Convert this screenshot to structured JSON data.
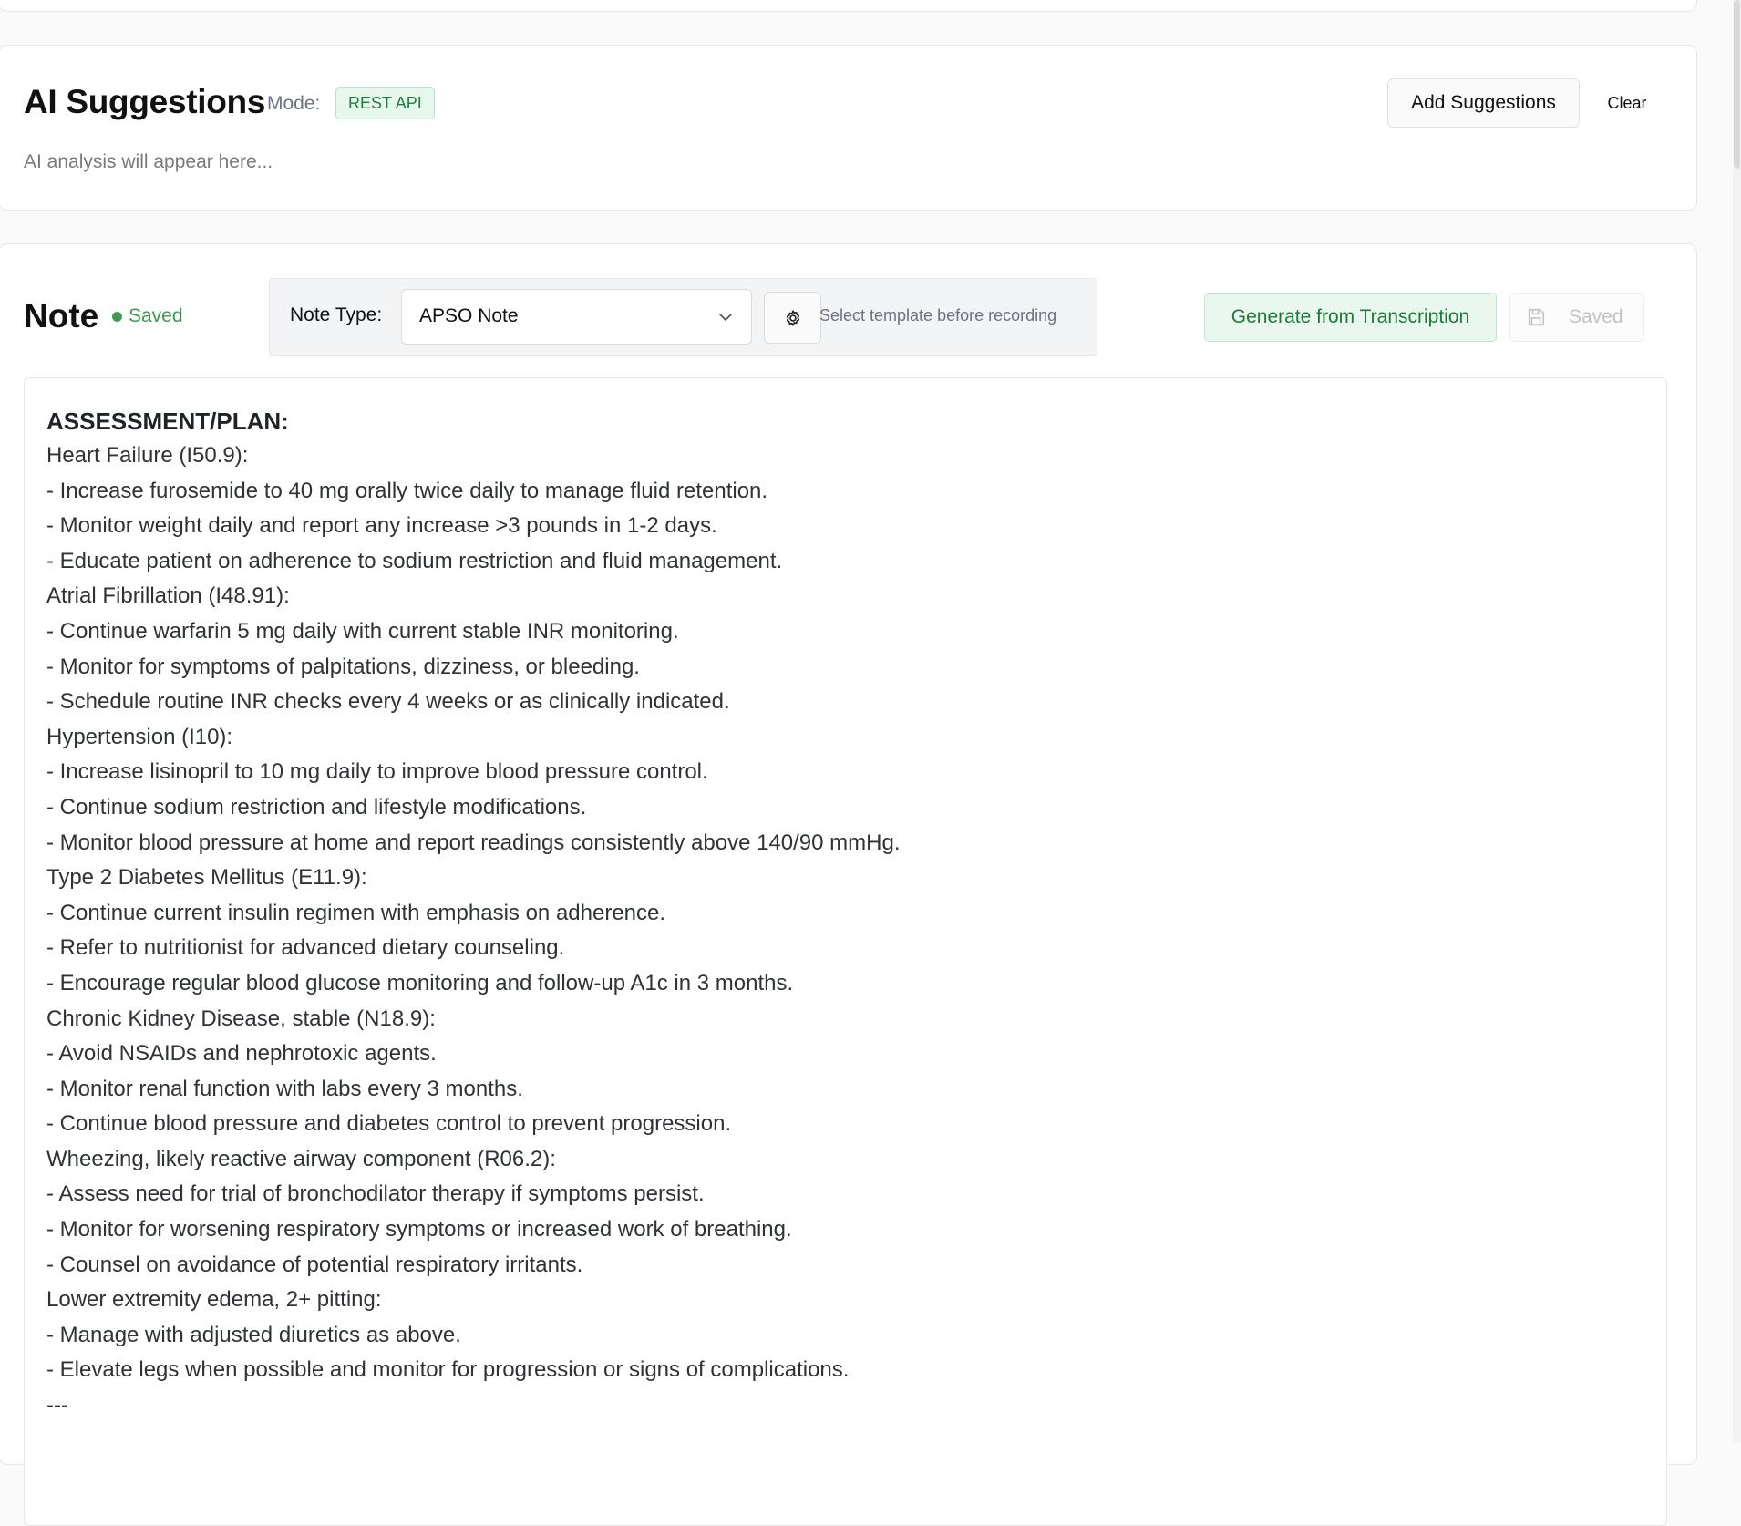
{
  "ai_suggestions": {
    "title": "AI Suggestions",
    "mode_label": "Mode:",
    "mode_value": "REST API",
    "add_button": "Add Suggestions",
    "clear_button": "Clear",
    "placeholder": "AI analysis will appear here..."
  },
  "note": {
    "title": "Note",
    "status": "Saved",
    "note_type_label": "Note Type:",
    "note_type_value": "APSO Note",
    "template_hint": "Select template before recording",
    "generate_button": "Generate from Transcription",
    "save_button": "Saved",
    "editor": {
      "heading": "ASSESSMENT/PLAN:",
      "lines": [
        "Heart Failure (I50.9):",
        "- Increase furosemide to 40 mg orally twice daily to manage fluid retention.",
        "- Monitor weight daily and report any increase >3 pounds in 1-2 days.",
        "- Educate patient on adherence to sodium restriction and fluid management.",
        "Atrial Fibrillation (I48.91):",
        "- Continue warfarin 5 mg daily with current stable INR monitoring.",
        "- Monitor for symptoms of palpitations, dizziness, or bleeding.",
        "- Schedule routine INR checks every 4 weeks or as clinically indicated.",
        "Hypertension (I10):",
        "- Increase lisinopril to 10 mg daily to improve blood pressure control.",
        "- Continue sodium restriction and lifestyle modifications.",
        "- Monitor blood pressure at home and report readings consistently above 140/90 mmHg.",
        "Type 2 Diabetes Mellitus (E11.9):",
        "- Continue current insulin regimen with emphasis on adherence.",
        "- Refer to nutritionist for advanced dietary counseling.",
        "- Encourage regular blood glucose monitoring and follow-up A1c in 3 months.",
        "Chronic Kidney Disease, stable (N18.9):",
        "- Avoid NSAIDs and nephrotoxic agents.",
        "- Monitor renal function with labs every 3 months.",
        "- Continue blood pressure and diabetes control to prevent progression.",
        "Wheezing, likely reactive airway component (R06.2):",
        "- Assess need for trial of bronchodilator therapy if symptoms persist.",
        "- Monitor for worsening respiratory symptoms or increased work of breathing.",
        "- Counsel on avoidance of potential respiratory irritants.",
        "Lower extremity edema, 2+ pitting:",
        "- Manage with adjusted diuretics as above.",
        "- Elevate legs when possible and monitor for progression or signs of complications.",
        "---"
      ]
    }
  },
  "icons": {
    "chevron": "chevron-down-icon",
    "settings": "gear-icon",
    "save": "floppy-disk-icon"
  },
  "colors": {
    "accent_green": "#3f9a52",
    "badge_bg": "#e8f7ec",
    "badge_text": "#1e7d3d"
  }
}
